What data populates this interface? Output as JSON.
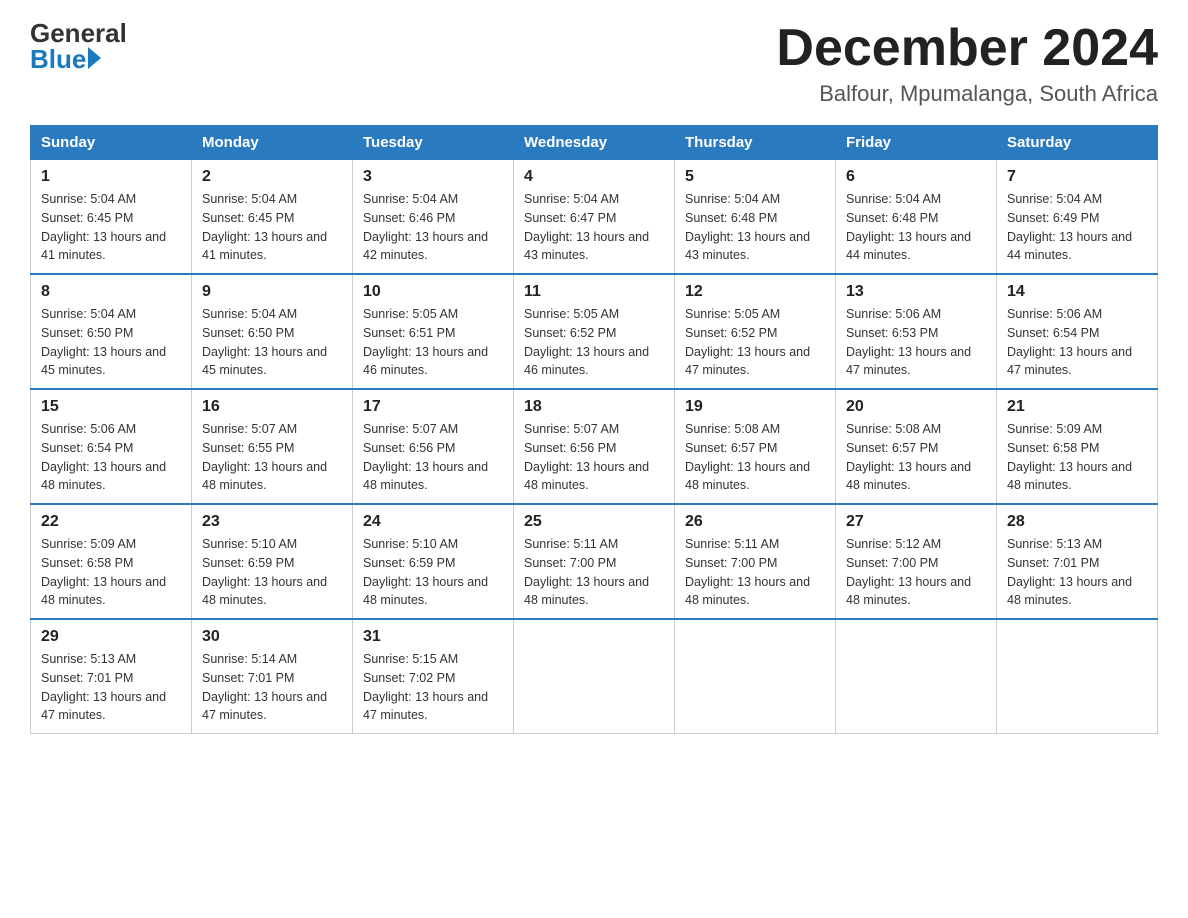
{
  "header": {
    "logo_general": "General",
    "logo_blue": "Blue",
    "month_title": "December 2024",
    "subtitle": "Balfour, Mpumalanga, South Africa"
  },
  "weekdays": [
    "Sunday",
    "Monday",
    "Tuesday",
    "Wednesday",
    "Thursday",
    "Friday",
    "Saturday"
  ],
  "weeks": [
    [
      {
        "day": "1",
        "sunrise": "5:04 AM",
        "sunset": "6:45 PM",
        "daylight": "13 hours and 41 minutes."
      },
      {
        "day": "2",
        "sunrise": "5:04 AM",
        "sunset": "6:45 PM",
        "daylight": "13 hours and 41 minutes."
      },
      {
        "day": "3",
        "sunrise": "5:04 AM",
        "sunset": "6:46 PM",
        "daylight": "13 hours and 42 minutes."
      },
      {
        "day": "4",
        "sunrise": "5:04 AM",
        "sunset": "6:47 PM",
        "daylight": "13 hours and 43 minutes."
      },
      {
        "day": "5",
        "sunrise": "5:04 AM",
        "sunset": "6:48 PM",
        "daylight": "13 hours and 43 minutes."
      },
      {
        "day": "6",
        "sunrise": "5:04 AM",
        "sunset": "6:48 PM",
        "daylight": "13 hours and 44 minutes."
      },
      {
        "day": "7",
        "sunrise": "5:04 AM",
        "sunset": "6:49 PM",
        "daylight": "13 hours and 44 minutes."
      }
    ],
    [
      {
        "day": "8",
        "sunrise": "5:04 AM",
        "sunset": "6:50 PM",
        "daylight": "13 hours and 45 minutes."
      },
      {
        "day": "9",
        "sunrise": "5:04 AM",
        "sunset": "6:50 PM",
        "daylight": "13 hours and 45 minutes."
      },
      {
        "day": "10",
        "sunrise": "5:05 AM",
        "sunset": "6:51 PM",
        "daylight": "13 hours and 46 minutes."
      },
      {
        "day": "11",
        "sunrise": "5:05 AM",
        "sunset": "6:52 PM",
        "daylight": "13 hours and 46 minutes."
      },
      {
        "day": "12",
        "sunrise": "5:05 AM",
        "sunset": "6:52 PM",
        "daylight": "13 hours and 47 minutes."
      },
      {
        "day": "13",
        "sunrise": "5:06 AM",
        "sunset": "6:53 PM",
        "daylight": "13 hours and 47 minutes."
      },
      {
        "day": "14",
        "sunrise": "5:06 AM",
        "sunset": "6:54 PM",
        "daylight": "13 hours and 47 minutes."
      }
    ],
    [
      {
        "day": "15",
        "sunrise": "5:06 AM",
        "sunset": "6:54 PM",
        "daylight": "13 hours and 48 minutes."
      },
      {
        "day": "16",
        "sunrise": "5:07 AM",
        "sunset": "6:55 PM",
        "daylight": "13 hours and 48 minutes."
      },
      {
        "day": "17",
        "sunrise": "5:07 AM",
        "sunset": "6:56 PM",
        "daylight": "13 hours and 48 minutes."
      },
      {
        "day": "18",
        "sunrise": "5:07 AM",
        "sunset": "6:56 PM",
        "daylight": "13 hours and 48 minutes."
      },
      {
        "day": "19",
        "sunrise": "5:08 AM",
        "sunset": "6:57 PM",
        "daylight": "13 hours and 48 minutes."
      },
      {
        "day": "20",
        "sunrise": "5:08 AM",
        "sunset": "6:57 PM",
        "daylight": "13 hours and 48 minutes."
      },
      {
        "day": "21",
        "sunrise": "5:09 AM",
        "sunset": "6:58 PM",
        "daylight": "13 hours and 48 minutes."
      }
    ],
    [
      {
        "day": "22",
        "sunrise": "5:09 AM",
        "sunset": "6:58 PM",
        "daylight": "13 hours and 48 minutes."
      },
      {
        "day": "23",
        "sunrise": "5:10 AM",
        "sunset": "6:59 PM",
        "daylight": "13 hours and 48 minutes."
      },
      {
        "day": "24",
        "sunrise": "5:10 AM",
        "sunset": "6:59 PM",
        "daylight": "13 hours and 48 minutes."
      },
      {
        "day": "25",
        "sunrise": "5:11 AM",
        "sunset": "7:00 PM",
        "daylight": "13 hours and 48 minutes."
      },
      {
        "day": "26",
        "sunrise": "5:11 AM",
        "sunset": "7:00 PM",
        "daylight": "13 hours and 48 minutes."
      },
      {
        "day": "27",
        "sunrise": "5:12 AM",
        "sunset": "7:00 PM",
        "daylight": "13 hours and 48 minutes."
      },
      {
        "day": "28",
        "sunrise": "5:13 AM",
        "sunset": "7:01 PM",
        "daylight": "13 hours and 48 minutes."
      }
    ],
    [
      {
        "day": "29",
        "sunrise": "5:13 AM",
        "sunset": "7:01 PM",
        "daylight": "13 hours and 47 minutes."
      },
      {
        "day": "30",
        "sunrise": "5:14 AM",
        "sunset": "7:01 PM",
        "daylight": "13 hours and 47 minutes."
      },
      {
        "day": "31",
        "sunrise": "5:15 AM",
        "sunset": "7:02 PM",
        "daylight": "13 hours and 47 minutes."
      },
      null,
      null,
      null,
      null
    ]
  ]
}
